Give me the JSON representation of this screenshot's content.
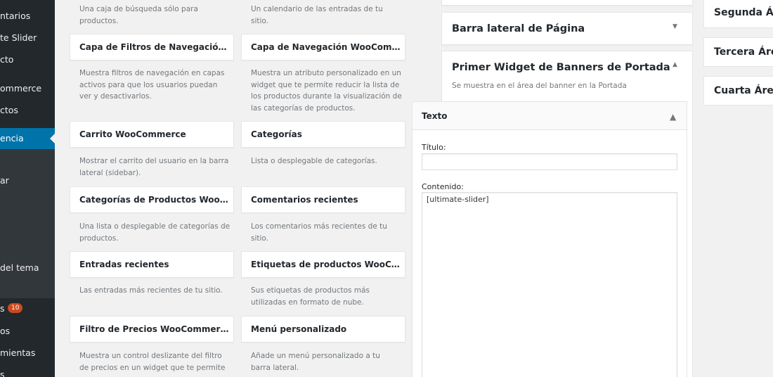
{
  "sidebar": {
    "items": [
      {
        "label": "ntarios",
        "active": false
      },
      {
        "label": "te Slider",
        "active": false
      },
      {
        "label": "cto",
        "active": false
      },
      {
        "label": "ommerce",
        "active": false
      },
      {
        "label": "ctos",
        "active": false
      },
      {
        "label": "encia",
        "active": true
      },
      {
        "label": "ar",
        "active": false
      },
      {
        "label": "del tema",
        "active": false
      },
      {
        "label": "s",
        "active": false,
        "badge": "10"
      },
      {
        "label": "os",
        "active": false
      },
      {
        "label": "mientas",
        "active": false
      },
      {
        "label": "s",
        "active": false
      }
    ]
  },
  "available_widgets": {
    "top_left_desc": "Una caja de búsqueda sólo para productos.",
    "top_right_desc": "Un calendario de las entradas de tu sitio.",
    "left": [
      {
        "title": "Capa de Filtros de Navegación Woo...",
        "desc": "Muestra filtros de navegación en capas activos para que los usuarios puedan ver y desactivarlos."
      },
      {
        "title": "Carrito WooCommerce",
        "desc": "Mostrar el carrito del usuario en la barra lateral (sidebar)."
      },
      {
        "title": "Categorías de Productos WooComm...",
        "desc": "Una lista o desplegable de categorías de productos."
      },
      {
        "title": "Entradas recientes",
        "desc": "Las entradas más recientes de tu sitio."
      },
      {
        "title": "Filtro de Precios WooCommerce",
        "desc": "Muestra un control deslizante del filtro de precios en un widget que te permite"
      }
    ],
    "right": [
      {
        "title": "Capa de Navegación WooCommerce",
        "desc": "Muestra un atributo personalizado en un widget que te permite reducir la lista de los productos durante la visualización de las categorías de productos."
      },
      {
        "title": "Categorías",
        "desc": "Lista o desplegable de categorías."
      },
      {
        "title": "Comentarios recientes",
        "desc": "Los comentarios más recientes de tu sitio."
      },
      {
        "title": "Etiquetas de productos WooComme...",
        "desc": "Sus etiquetas de productos más utilizadas en formato de nube."
      },
      {
        "title": "Menú personalizado",
        "desc": "Añade un menú personalizado a tu barra lateral."
      }
    ]
  },
  "widget_areas": {
    "page_sidebar": {
      "title": "Barra lateral de Página"
    },
    "banner_area": {
      "title": "Primer Widget de Banners de Portada",
      "desc": "Se muestra en el área del banner en la Portada"
    },
    "text_widget": {
      "title": "Texto",
      "title_label": "Título:",
      "title_value": "",
      "content_label": "Contenido:",
      "content_value": "[ultimate-slider]"
    },
    "right_column": [
      {
        "title": "Segunda Áre"
      },
      {
        "title": "Tercera Área"
      },
      {
        "title": "Cuarta Área"
      }
    ]
  },
  "icons": {
    "collapse_arrow": "arrow-down-icon",
    "expand_arrow": "arrow-up-icon"
  },
  "colors": {
    "sidebar_bg": "#23282d",
    "active_menu": "#0073aa",
    "badge": "#ca4a1f"
  }
}
